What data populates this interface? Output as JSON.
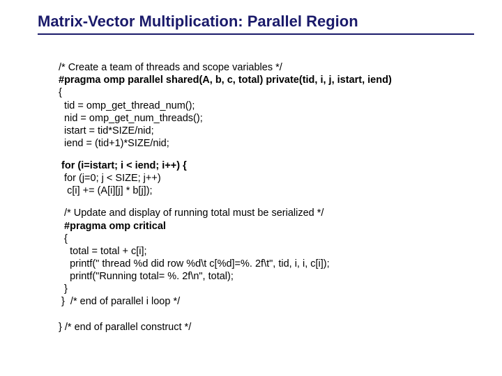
{
  "title": "Matrix-Vector Multiplication: Parallel Region",
  "code": {
    "l1": "/* Create a team of threads and scope variables */",
    "l2": "#pragma omp parallel shared(A, b, c, total) private(tid, i, j, istart, iend)",
    "l3": "{",
    "l4": "  tid = omp_get_thread_num();",
    "l5": "  nid = omp_get_num_threads();",
    "l6": "  istart = tid*SIZE/nid;",
    "l7": "  iend = (tid+1)*SIZE/nid;",
    "l8": " for (i=istart; i < iend; i++) {",
    "l9": "  for (j=0; j < SIZE; j++)",
    "l10": "   c[i] += (A[i][j] * b[j]);",
    "l11": "  /* Update and display of running total must be serialized */",
    "l12": "  #pragma omp critical",
    "l13": "  {",
    "l14": "    total = total + c[i];",
    "l15": "    printf(\" thread %d did row %d\\t c[%d]=%. 2f\\t\", tid, i, i, c[i]);",
    "l16": "    printf(\"Running total= %. 2f\\n\", total);",
    "l17": "  }",
    "l18": " }  /* end of parallel i loop */",
    "l19": "} /* end of parallel construct */"
  }
}
